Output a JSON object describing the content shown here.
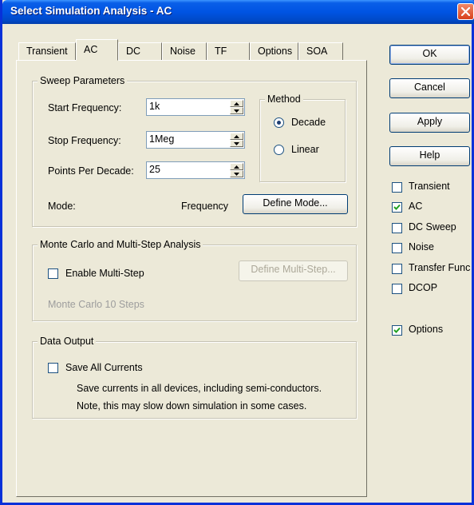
{
  "window": {
    "title": "Select Simulation Analysis - AC"
  },
  "tabs": [
    {
      "label": "Transient",
      "active": false
    },
    {
      "label": "AC",
      "active": true
    },
    {
      "label": "DC",
      "active": false
    },
    {
      "label": "Noise",
      "active": false
    },
    {
      "label": "TF",
      "active": false
    },
    {
      "label": "Options",
      "active": false
    },
    {
      "label": "SOA",
      "active": false
    }
  ],
  "sweep": {
    "title": "Sweep Parameters",
    "start_label": "Start Frequency:",
    "start_value": "1k",
    "stop_label": "Stop Frequency:",
    "stop_value": "1Meg",
    "points_label": "Points Per Decade:",
    "points_value": "25",
    "mode_label": "Mode:",
    "mode_value": "Frequency",
    "define_mode_label": "Define Mode...",
    "method": {
      "title": "Method",
      "decade_label": "Decade",
      "linear_label": "Linear",
      "selected": "Decade"
    }
  },
  "monte_carlo": {
    "title": "Monte Carlo and Multi-Step Analysis",
    "enable_label": "Enable Multi-Step",
    "enable_checked": false,
    "define_label": "Define Multi-Step...",
    "steps_text": "Monte Carlo 10 Steps"
  },
  "data_output": {
    "title": "Data Output",
    "save_label": "Save All Currents",
    "save_checked": false,
    "note1": "Save currents in all devices, including semi-conductors.",
    "note2": "Note, this may slow down simulation in some cases."
  },
  "buttons": {
    "ok": "OK",
    "cancel": "Cancel",
    "apply": "Apply",
    "help": "Help"
  },
  "analyses": [
    {
      "label": "Transient",
      "checked": false
    },
    {
      "label": "AC",
      "checked": true
    },
    {
      "label": "DC Sweep",
      "checked": false
    },
    {
      "label": "Noise",
      "checked": false
    },
    {
      "label": "Transfer Func",
      "checked": false
    },
    {
      "label": "DCOP",
      "checked": false
    }
  ],
  "options": {
    "label": "Options",
    "checked": true
  }
}
